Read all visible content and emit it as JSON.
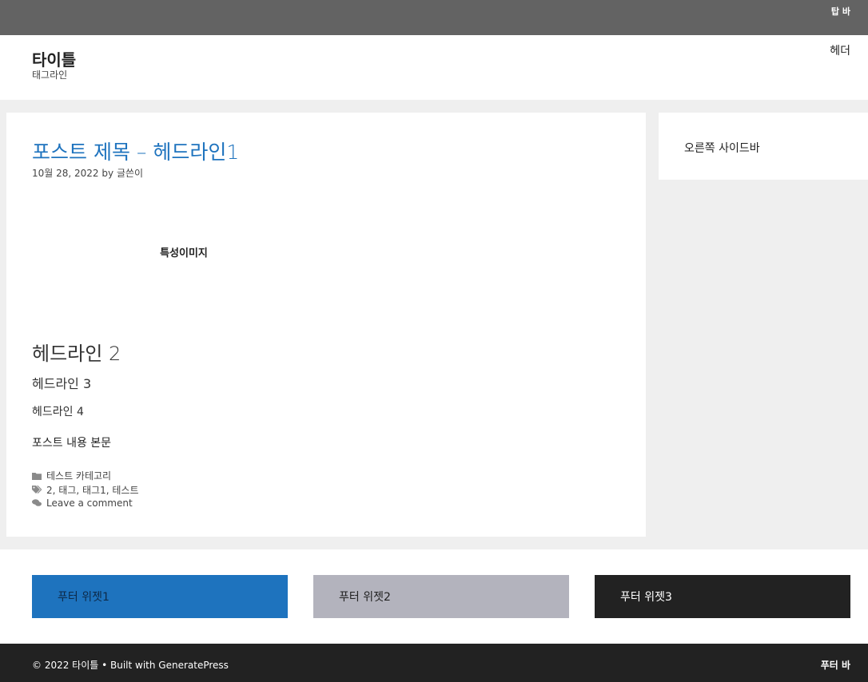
{
  "top_bar": {
    "text": "탑 바"
  },
  "header": {
    "site_title": "타이틀",
    "tagline": "태그라인",
    "widget": "헤더"
  },
  "post": {
    "title": "포스트 제목 – 헤드라인1",
    "date": "10월 28, 2022",
    "by": "by",
    "author": "글쓴이",
    "featured_image": "특성이미지",
    "h2": "헤드라인 2",
    "h3": "헤드라인 3",
    "h4": "헤드라인 4",
    "body": "포스트 내용 본문",
    "category": "테스트 카테고리",
    "tags": [
      "2",
      "태그",
      "태그1",
      "테스트"
    ],
    "comment_link": "Leave a comment"
  },
  "sidebar": {
    "text": "오른쪽 사이드바"
  },
  "footer_widgets": [
    "푸터 위젯1",
    "푸터 위젯2",
    "푸터 위젯3"
  ],
  "footer_bar": {
    "copyright": "© 2022 타이틀 • Built with GeneratePress",
    "widget": "푸터 바"
  },
  "colors": {
    "accent": "#1e73be",
    "top_bar": "#636363",
    "footer_widget_2": "#b3b3bd",
    "dark": "#222222"
  },
  "icons": {
    "category": "folder-icon",
    "tags": "tags-icon",
    "comments": "comments-icon"
  }
}
